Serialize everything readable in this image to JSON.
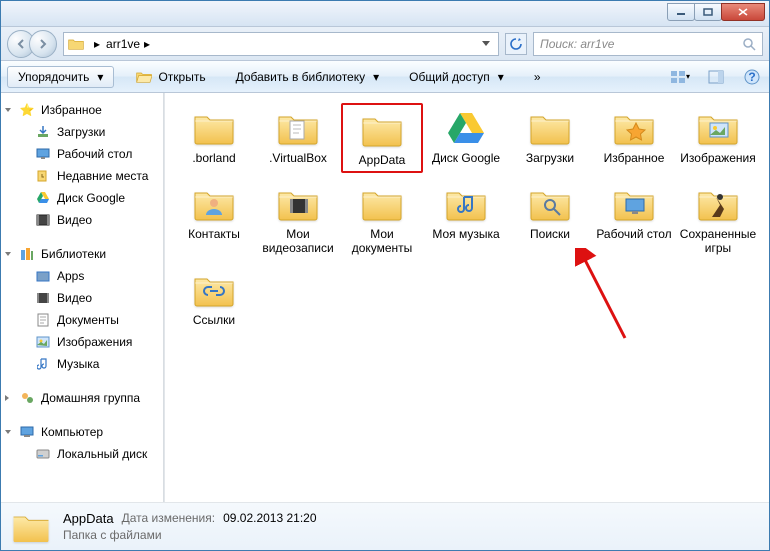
{
  "breadcrumb": [
    "",
    "arr1ve"
  ],
  "search": {
    "placeholder": "Поиск: arr1ve"
  },
  "toolbar": {
    "organize": "Упорядочить",
    "open": "Открыть",
    "includeInLibrary": "Добавить в библиотеку",
    "shareWith": "Общий доступ",
    "overflow": "»"
  },
  "sidebar": {
    "favorites": {
      "label": "Избранное",
      "items": [
        "Загрузки",
        "Рабочий стол",
        "Недавние места",
        "Диск Google",
        "Видео"
      ]
    },
    "libraries": {
      "label": "Библиотеки",
      "items": [
        "Apps",
        "Видео",
        "Документы",
        "Изображения",
        "Музыка"
      ]
    },
    "homegroup": {
      "label": "Домашняя группа"
    },
    "computer": {
      "label": "Компьютер",
      "items": [
        "Локальный диск"
      ]
    }
  },
  "items": [
    {
      "label": ".borland",
      "icon": "folder"
    },
    {
      "label": ".VirtualBox",
      "icon": "folder-doc"
    },
    {
      "label": "AppData",
      "icon": "folder",
      "highlight": true
    },
    {
      "label": "Диск Google",
      "icon": "gdrive"
    },
    {
      "label": "Загрузки",
      "icon": "folder"
    },
    {
      "label": "Избранное",
      "icon": "folder-star"
    },
    {
      "label": "Изображения",
      "icon": "folder-pic"
    },
    {
      "label": "Контакты",
      "icon": "folder-contact"
    },
    {
      "label": "Мои видеозаписи",
      "icon": "folder-video"
    },
    {
      "label": "Мои документы",
      "icon": "folder"
    },
    {
      "label": "Моя музыка",
      "icon": "folder-music"
    },
    {
      "label": "Поиски",
      "icon": "folder-search"
    },
    {
      "label": "Рабочий стол",
      "icon": "folder-desktop"
    },
    {
      "label": "Сохраненные игры",
      "icon": "folder-games"
    },
    {
      "label": "Ссылки",
      "icon": "folder-link"
    }
  ],
  "status": {
    "name": "AppData",
    "type": "Папка с файлами",
    "dateLabel": "Дата изменения:",
    "dateValue": "09.02.2013 21:20"
  }
}
